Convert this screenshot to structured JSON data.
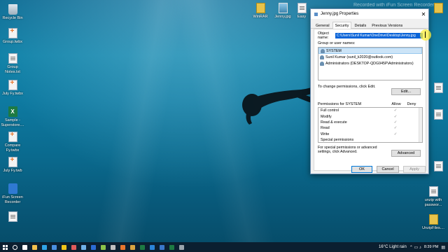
{
  "desktop": {
    "watermark": "Recorded with iFun Screen Recorder",
    "left_icons": [
      {
        "label": "Recycle Bin",
        "icon": "recycle-bin-icon"
      },
      {
        "label": "Group.twbx",
        "icon": "tableau-file-icon"
      },
      {
        "label": "Group Notes.txt",
        "icon": "text-file-icon"
      },
      {
        "label": "July Fy.twbx",
        "icon": "tableau-file-icon"
      },
      {
        "label": "Sample - Superstore....",
        "icon": "excel-file-icon"
      },
      {
        "label": "Compare Fy.twbx",
        "icon": "tableau-file-icon"
      },
      {
        "label": "July Fy.twb",
        "icon": "tableau-file-icon"
      },
      {
        "label": "iFun Screen Recorder",
        "icon": "recorder-app-icon"
      },
      {
        "label": "",
        "icon": "text-file-icon"
      }
    ],
    "top_icons": [
      {
        "label": "WinRAR",
        "icon": "winrar-icon"
      },
      {
        "label": "Jenny.jpg",
        "icon": "image-file-icon"
      },
      {
        "label": "Easy",
        "icon": "document-icon"
      }
    ],
    "right_icons": [
      {
        "label": "",
        "icon": "folder-icon"
      },
      {
        "label": "",
        "icon": "document-icon"
      },
      {
        "label": "",
        "icon": "document-icon"
      },
      {
        "label": "",
        "icon": "document-icon"
      },
      {
        "label": "unzip with passwor...",
        "icon": "text-file-icon"
      },
      {
        "label": "UnzipFiles....",
        "icon": "zip-file-icon"
      }
    ]
  },
  "dialog": {
    "title": "Jenny.jpg Properties",
    "close": "✕",
    "tabs": [
      "General",
      "Security",
      "Details",
      "Previous Versions"
    ],
    "active_tab": "Security",
    "object_name_label": "Object name:",
    "object_name_value": "C:\\Users\\Sunil Kumar\\OneDrive\\Desktop\\Jenny.jpg",
    "group_label": "Group or user names:",
    "users": [
      {
        "name": "SYSTEM",
        "selected": true
      },
      {
        "name": "Sunil Kumar (sunil_k2020@outlook.com)",
        "selected": false
      },
      {
        "name": "Administrators (DESKTOP-QDG945P\\Administrators)",
        "selected": false
      }
    ],
    "change_text": "To change permissions, click Edit.",
    "edit_button": "Edit...",
    "perm_title": "Permissions for SYSTEM",
    "allow_header": "Allow",
    "deny_header": "Deny",
    "permissions": [
      {
        "name": "Full control",
        "allow": "✓",
        "deny": ""
      },
      {
        "name": "Modify",
        "allow": "✓",
        "deny": ""
      },
      {
        "name": "Read & execute",
        "allow": "✓",
        "deny": ""
      },
      {
        "name": "Read",
        "allow": "✓",
        "deny": ""
      },
      {
        "name": "Write",
        "allow": "✓",
        "deny": ""
      },
      {
        "name": "Special permissions",
        "allow": "",
        "deny": ""
      }
    ],
    "advanced_text": "For special permissions or advanced settings, click Advanced.",
    "advanced_button": "Advanced",
    "ok_button": "OK",
    "cancel_button": "Cancel",
    "apply_button": "Apply"
  },
  "taskbar": {
    "weather": "16°C  Light rain",
    "time": "8:39 PM",
    "pinned": [
      {
        "icon": "search-icon",
        "color": "#ffffff"
      },
      {
        "icon": "task-view-icon",
        "color": "#ffffff"
      },
      {
        "icon": "file-explorer-icon",
        "color": "#f2c14e"
      },
      {
        "icon": "edge-icon",
        "color": "#2fa3e6"
      },
      {
        "icon": "store-icon",
        "color": "#4a8fe0"
      },
      {
        "icon": "chrome-icon",
        "color": "#f0c419"
      },
      {
        "icon": "paint-icon",
        "color": "#e05b5b"
      },
      {
        "icon": "app-icon",
        "color": "#6fb1e8"
      },
      {
        "icon": "word-icon",
        "color": "#2b6cd4"
      },
      {
        "icon": "app-icon",
        "color": "#8bc34a"
      },
      {
        "icon": "app-icon",
        "color": "#c0c0c0"
      },
      {
        "icon": "tableau-icon",
        "color": "#e8762d"
      },
      {
        "icon": "app-icon",
        "color": "#d9a441"
      },
      {
        "icon": "excel-icon",
        "color": "#1d7a43"
      },
      {
        "icon": "vscode-icon",
        "color": "#2b84d8"
      },
      {
        "icon": "photos-icon",
        "color": "#3a77c9"
      },
      {
        "icon": "excel-icon",
        "color": "#1d7a43"
      },
      {
        "icon": "settings-icon",
        "color": "#9aa4ad"
      }
    ]
  }
}
